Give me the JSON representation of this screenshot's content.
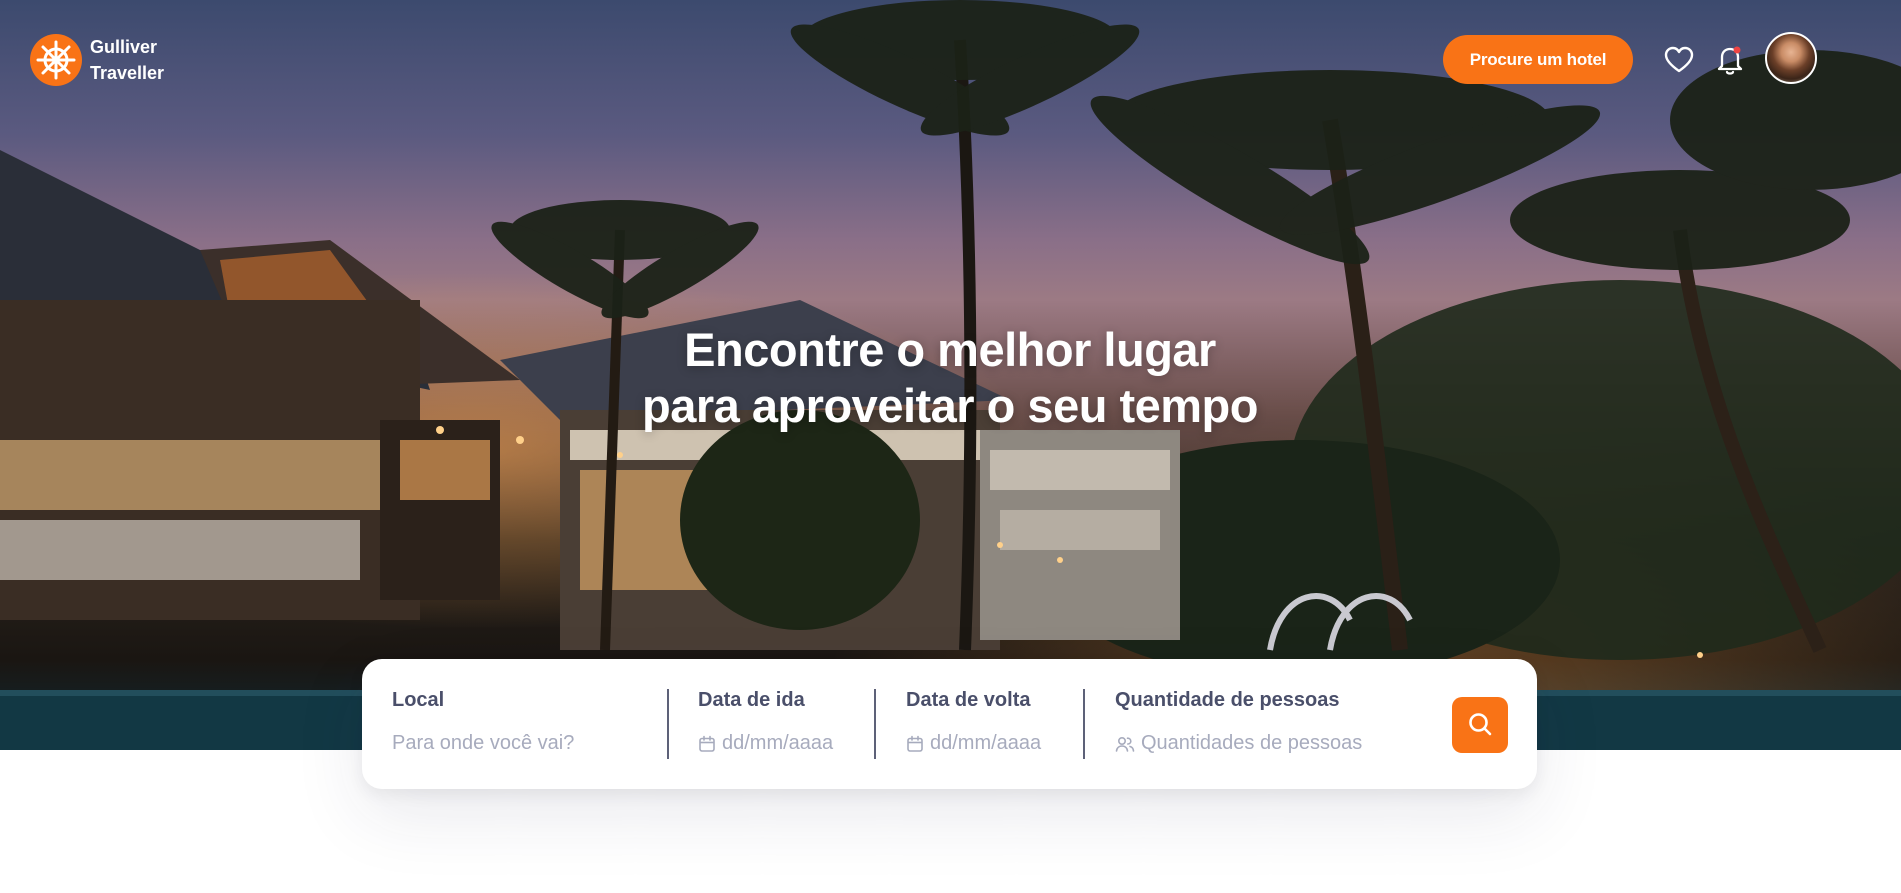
{
  "brand": {
    "name_line1": "Gulliver",
    "name_line2": "Traveller"
  },
  "header": {
    "cta_label": "Procure um hotel",
    "favorites_icon": "heart-icon",
    "notifications_icon": "bell-icon",
    "notification_dot_color": "#ef4444"
  },
  "hero": {
    "headline_line1": "Encontre o melhor lugar",
    "headline_line2": "para aproveitar o seu tempo"
  },
  "search": {
    "local": {
      "label": "Local",
      "placeholder": "Para onde você vai?"
    },
    "departure": {
      "label": "Data de ida",
      "placeholder": "dd/mm/aaaa",
      "icon": "calendar-icon"
    },
    "return": {
      "label": "Data de volta",
      "placeholder": "dd/mm/aaaa",
      "icon": "calendar-icon"
    },
    "guests": {
      "label": "Quantidade de pessoas",
      "placeholder": "Quantidades de pessoas",
      "icon": "users-icon"
    },
    "submit_icon": "search-icon"
  },
  "colors": {
    "accent": "#f97316",
    "label": "#4a4f6a",
    "placeholder": "#a7abbd"
  }
}
